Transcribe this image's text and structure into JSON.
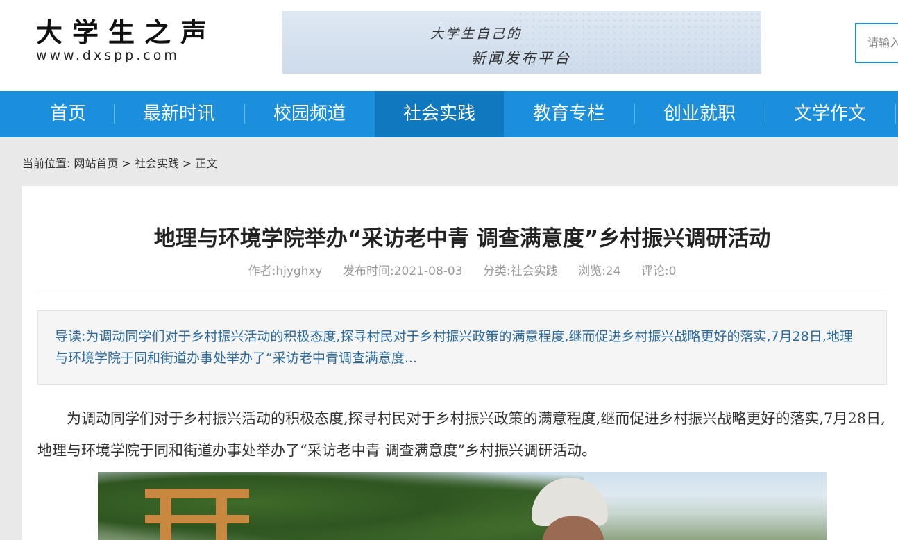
{
  "site": {
    "logo_title": "大学生之声",
    "logo_url": "www.dxspp.com",
    "banner_line1": "大学生自己的",
    "banner_line2": "新闻发布平台",
    "search_placeholder": "请输入"
  },
  "nav": {
    "items": [
      {
        "label": "首页"
      },
      {
        "label": "最新时讯"
      },
      {
        "label": "校园频道"
      },
      {
        "label": "社会实践"
      },
      {
        "label": "教育专栏"
      },
      {
        "label": "创业就职"
      },
      {
        "label": "文学作文"
      }
    ],
    "active": "社会实践"
  },
  "breadcrumb": {
    "prefix": "当前位置:",
    "home": "网站首页",
    "sep1": ">",
    "category": "社会实践",
    "sep2": ">",
    "current": "正文"
  },
  "article": {
    "title": "地理与环境学院举办“采访老中青 调查满意度”乡村振兴调研活动",
    "author": "作者:hjyghxy",
    "date": "发布时间:2021-08-03",
    "category": "分类:社会实践",
    "views": "浏览:24",
    "comments": "评论:0",
    "summary": "导读:为调动同学们对于乡村振兴活动的积极态度,探寻村民对于乡村振兴政策的满意程度,继而促进乡村振兴战略更好的落实,7月28日,地理与环境学院于同和街道办事处举办了“采访老中青调查满意度...",
    "body": "为调动同学们对于乡村振兴活动的积极态度,探寻村民对于乡村振兴政策的满意程度,继而促进乡村振兴战略更好的落实,7月28日,地理与环境学院于同和街道办事处举办了“采访老中青 调查满意度”乡村振兴调研活动。"
  },
  "colors": {
    "nav_bg": "#1b8fdb",
    "nav_active": "#0f78be",
    "summary_text": "#2b6a9e"
  }
}
